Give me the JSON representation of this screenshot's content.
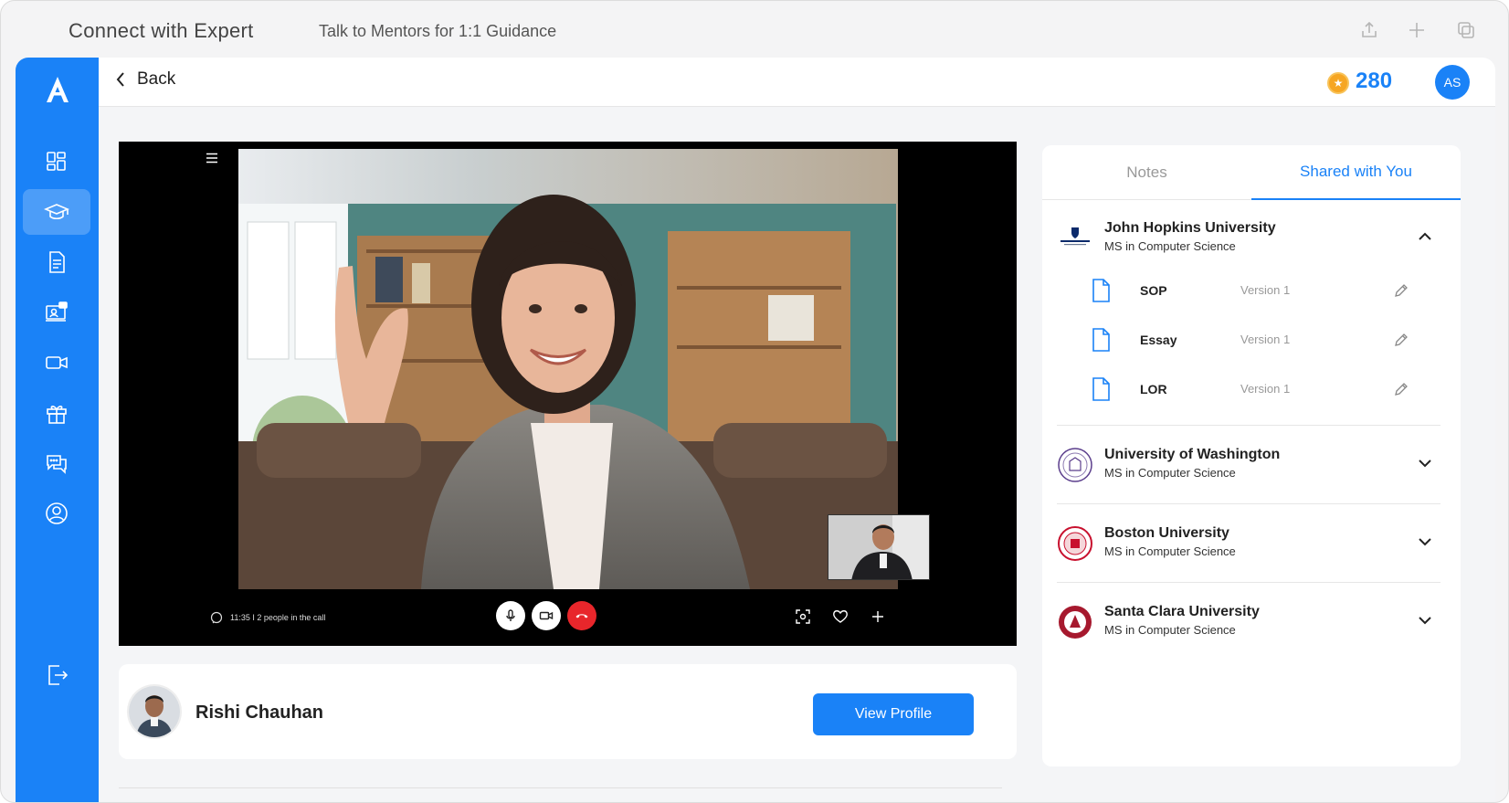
{
  "window": {
    "title": "Connect with Expert",
    "subtitle": "Talk to Mentors for 1:1 Guidance",
    "icons": [
      "share-icon",
      "plus-icon",
      "duplicate-icon"
    ]
  },
  "sidebar": {
    "logo_letter": "A",
    "items": [
      {
        "name": "dashboard-icon",
        "active": false
      },
      {
        "name": "graduation-cap-icon",
        "active": true
      },
      {
        "name": "document-icon",
        "active": false
      },
      {
        "name": "presentation-icon",
        "active": false
      },
      {
        "name": "video-icon",
        "active": false
      },
      {
        "name": "gift-icon",
        "active": false
      },
      {
        "name": "chat-icon",
        "active": false
      },
      {
        "name": "profile-icon",
        "active": false
      }
    ],
    "logout_icon": "logout-icon"
  },
  "topbar": {
    "back_label": "Back",
    "points": "280",
    "user_initials": "AS"
  },
  "video_call": {
    "status_text": "11:35 I 2 people in the call",
    "controls": [
      "mic-icon",
      "camera-icon",
      "end-call-icon"
    ],
    "actions": [
      "screenshot-icon",
      "heart-icon",
      "plus-icon"
    ]
  },
  "mentor": {
    "name": "Rishi Chauhan",
    "view_profile_label": "View Profile"
  },
  "panel": {
    "tabs": [
      {
        "label": "Notes",
        "active": false
      },
      {
        "label": "Shared with You",
        "active": true
      }
    ],
    "universities": [
      {
        "name": "John Hopkins University",
        "program": "MS in Computer Science",
        "expanded": true,
        "logo_color": "#0b2a6b",
        "documents": [
          {
            "name": "SOP",
            "version": "Version 1"
          },
          {
            "name": "Essay",
            "version": "Version 1"
          },
          {
            "name": "LOR",
            "version": "Version 1"
          }
        ]
      },
      {
        "name": "University of Washington",
        "program": "MS in Computer Science",
        "expanded": false,
        "logo_color": "#5b3e8c"
      },
      {
        "name": "Boston University",
        "program": "MS in Computer Science",
        "expanded": false,
        "logo_color": "#c8102e"
      },
      {
        "name": "Santa Clara University",
        "program": "MS in Computer Science",
        "expanded": false,
        "logo_color": "#a6192e"
      }
    ]
  },
  "colors": {
    "accent": "#1a82f7",
    "end_call": "#e8262b",
    "coin": "#f6a623"
  }
}
